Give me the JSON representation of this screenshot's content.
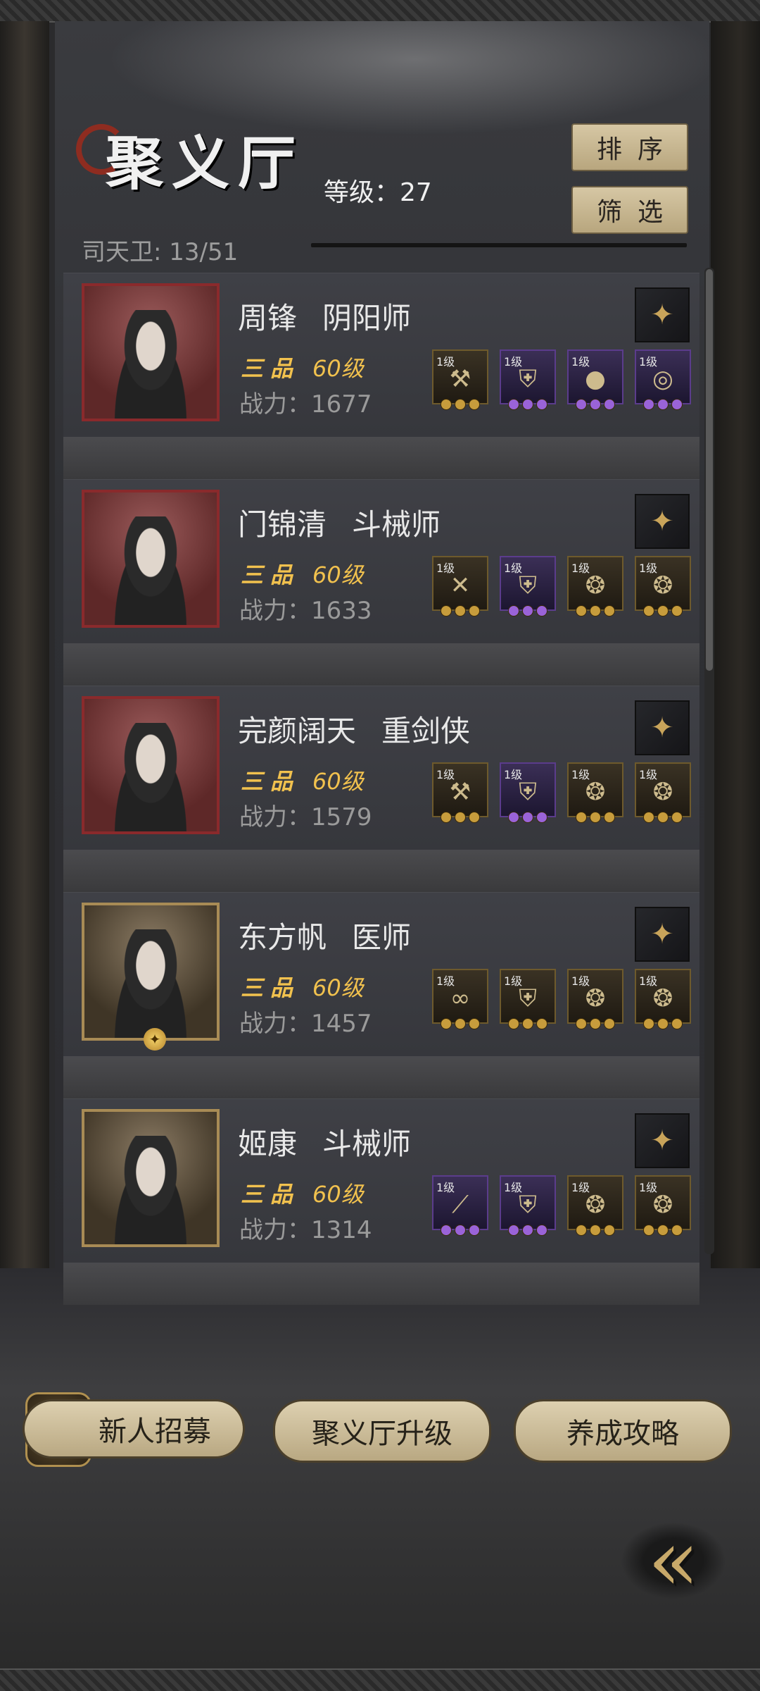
{
  "header": {
    "title": "聚义厅",
    "level_text": "等级：27",
    "guard_text": "司天卫: 13/51",
    "sort_label": "排序",
    "filter_label": "筛选"
  },
  "heroes": [
    {
      "name": "周锋",
      "class": "阴阳师",
      "grade": "三品",
      "level": "60级",
      "power": "战力：1677",
      "portrait_border": "red",
      "weapon_icon": "gold-scroll-icon",
      "equips": [
        {
          "lv": "1级",
          "quality": "gold",
          "icon": "axe-icon",
          "glyph": "⚒"
        },
        {
          "lv": "1级",
          "quality": "purple",
          "icon": "armor-icon",
          "glyph": "⛨"
        },
        {
          "lv": "1级",
          "quality": "purple",
          "icon": "orb-icon",
          "glyph": "●"
        },
        {
          "lv": "1级",
          "quality": "purple",
          "icon": "bead-bracelet-icon",
          "glyph": "◎"
        }
      ]
    },
    {
      "name": "门锦清",
      "class": "斗械师",
      "grade": "三品",
      "level": "60级",
      "power": "战力：1633",
      "portrait_border": "red",
      "weapon_icon": "mechanism-box-icon",
      "equips": [
        {
          "lv": "1级",
          "quality": "gold",
          "icon": "crossbow-icon",
          "glyph": "✕"
        },
        {
          "lv": "1级",
          "quality": "purple",
          "icon": "armor-icon",
          "glyph": "⛨"
        },
        {
          "lv": "1级",
          "quality": "gold",
          "icon": "pouch-icon",
          "glyph": "❂"
        },
        {
          "lv": "1级",
          "quality": "gold",
          "icon": "pouch-icon",
          "glyph": "❂"
        }
      ]
    },
    {
      "name": "完颜阔天",
      "class": "重剑侠",
      "grade": "三品",
      "level": "60级",
      "power": "战力：1579",
      "portrait_border": "red",
      "weapon_icon": "sword-icon",
      "equips": [
        {
          "lv": "1级",
          "quality": "gold",
          "icon": "axe-icon",
          "glyph": "⚒"
        },
        {
          "lv": "1级",
          "quality": "purple",
          "icon": "armor-icon",
          "glyph": "⛨"
        },
        {
          "lv": "1级",
          "quality": "gold",
          "icon": "pouch-icon",
          "glyph": "❂"
        },
        {
          "lv": "1级",
          "quality": "gold",
          "icon": "pouch-icon",
          "glyph": "❂"
        }
      ]
    },
    {
      "name": "东方帆",
      "class": "医师",
      "grade": "三品",
      "level": "60级",
      "power": "战力：1457",
      "portrait_border": "gold",
      "weapon_icon": "red-gem-icon",
      "equips": [
        {
          "lv": "1级",
          "quality": "gold",
          "icon": "gourd-icon",
          "glyph": "∞"
        },
        {
          "lv": "1级",
          "quality": "gold",
          "icon": "robe-icon",
          "glyph": "⛨"
        },
        {
          "lv": "1级",
          "quality": "gold",
          "icon": "pouch-icon",
          "glyph": "❂"
        },
        {
          "lv": "1级",
          "quality": "gold",
          "icon": "pouch-icon",
          "glyph": "❂"
        }
      ]
    },
    {
      "name": "姬康",
      "class": "斗械师",
      "grade": "三品",
      "level": "60级",
      "power": "战力：1314",
      "portrait_border": "gold",
      "weapon_icon": "golden-hammer-icon",
      "equips": [
        {
          "lv": "1级",
          "quality": "purple",
          "icon": "spear-icon",
          "glyph": "⟋"
        },
        {
          "lv": "1级",
          "quality": "purple",
          "icon": "armor-icon",
          "glyph": "⛨"
        },
        {
          "lv": "1级",
          "quality": "gold",
          "icon": "pouch-icon",
          "glyph": "❂"
        },
        {
          "lv": "1级",
          "quality": "gold",
          "icon": "pouch-icon",
          "glyph": "❂"
        }
      ]
    }
  ],
  "footer": {
    "recruit_label": "新人招募",
    "upgrade_label": "聚义厅升级",
    "guide_label": "养成攻略"
  },
  "colors": {
    "accent_gold": "#f1c14e",
    "button_tan": "#d6c7a4",
    "portrait_red": "#8a2a2c"
  }
}
